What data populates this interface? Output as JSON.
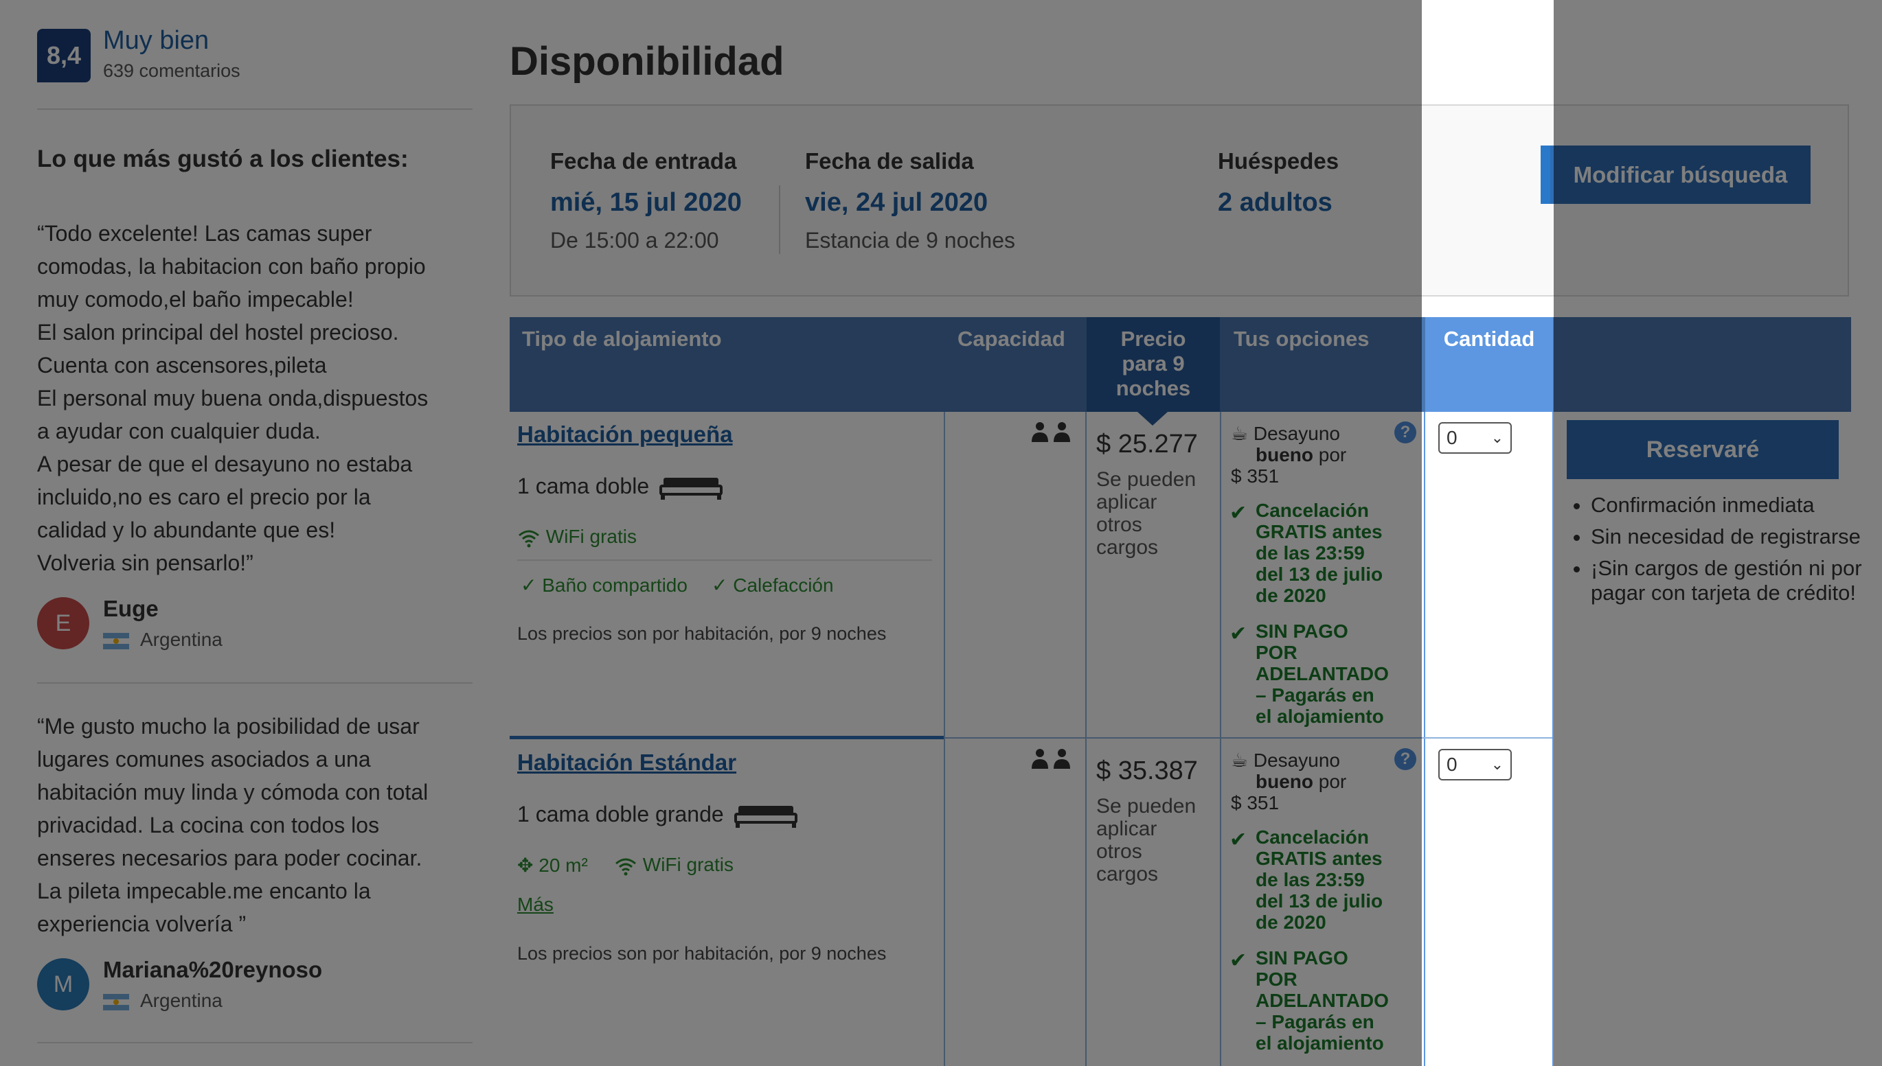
{
  "rating": {
    "score": "8,4",
    "label": "Muy bien",
    "reviews": "639 comentarios"
  },
  "liked_title": "Lo que más gustó a los clientes:",
  "reviews": [
    {
      "text": "“Todo excelente! Las camas super\ncomodas, la habitacion con baño propio\nmuy comodo,el baño impecable!\nEl salon principal del hostel precioso.\nCuenta con ascensores,pileta\nEl personal muy buena onda,dispuestos\na ayudar con cualquier duda.\nA pesar de que el desayuno no estaba\nincluido,no es caro el precio por la\ncalidad y lo abundante que es!\nVolveria sin pensarlo!”",
      "initial": "E",
      "name": "Euge",
      "country": "Argentina",
      "avatar_color": "#c94a4a"
    },
    {
      "text": "“Me gusto mucho la posibilidad de usar\nlugares comunes asociados a una\nhabitación muy linda y cómoda con total\nprivacidad. La cocina con todos los\nenseres necesarios para poder cocinar.\nLa pileta impecable.me encanto la\nexperiencia volvería ”",
      "initial": "M",
      "name": "Mariana%20reynoso",
      "country": "Argentina",
      "avatar_color": "#2a7ab8"
    }
  ],
  "availability": {
    "title": "Disponibilidad",
    "checkin_label": "Fecha de entrada",
    "checkin_value": "mié, 15 jul 2020",
    "checkin_time": "De 15:00 a 22:00",
    "checkout_label": "Fecha de salida",
    "checkout_value": "vie, 24 jul 2020",
    "stay": "Estancia de 9 noches",
    "guests_label": "Huéspedes",
    "guests_value": "2 adultos",
    "modify_button": "Modificar búsqueda"
  },
  "table": {
    "headers": {
      "type": "Tipo de alojamiento",
      "capacity": "Capacidad",
      "price": "Precio\npara 9\nnoches",
      "options": "Tus opciones",
      "quantity": "Cantidad"
    },
    "rooms": [
      {
        "name": "Habitación pequeña",
        "bed": "1 cama doble",
        "wifi": "WiFi gratis",
        "amenity1": "Baño compartido",
        "amenity2": "Calefacción",
        "note": "Los precios son por habitación, por 9 noches",
        "price": "$ 25.277",
        "price_note": "Se pueden\naplicar\notros\ncargos",
        "breakfast": "Desayuno",
        "breakfast_bold": "bueno",
        "breakfast_rest": "por\n$ 351",
        "cancel": "Cancelación\nGRATIS antes\nde las 23:59\ndel 13 de julio\nde 2020",
        "nopay": "SIN PAGO\nPOR\nADELANTADO\n– Pagarás en\nel alojamiento",
        "qty": "0"
      },
      {
        "name": "Habitación Estándar",
        "bed": "1 cama doble grande",
        "size": "20 m²",
        "wifi": "WiFi gratis",
        "more": "Más",
        "note": "Los precios son por habitación, por 9 noches",
        "price": "$ 35.387",
        "price_note": "Se pueden\naplicar\notros\ncargos",
        "breakfast": "Desayuno",
        "breakfast_bold": "bueno",
        "breakfast_rest": "por\n$ 351",
        "cancel": "Cancelación\nGRATIS antes\nde las 23:59\ndel 13 de julio\nde 2020",
        "nopay": "SIN PAGO\nPOR\nADELANTADO\n– Pagarás en\nel alojamiento",
        "qty": "0"
      }
    ],
    "reserve_button": "Reservaré",
    "benefits": [
      "Confirmación inmediata",
      "Sin necesidad de registrarse",
      "¡Sin cargos de gestión ni por pagar con tarjeta de crédito!"
    ]
  },
  "colors": {
    "brand_blue": "#1f5ea0",
    "header_blue": "#4a77b1",
    "button_blue": "#2e6db4",
    "green": "#2b8a30",
    "overlay": "rgba(0,0,0,0.5)"
  }
}
